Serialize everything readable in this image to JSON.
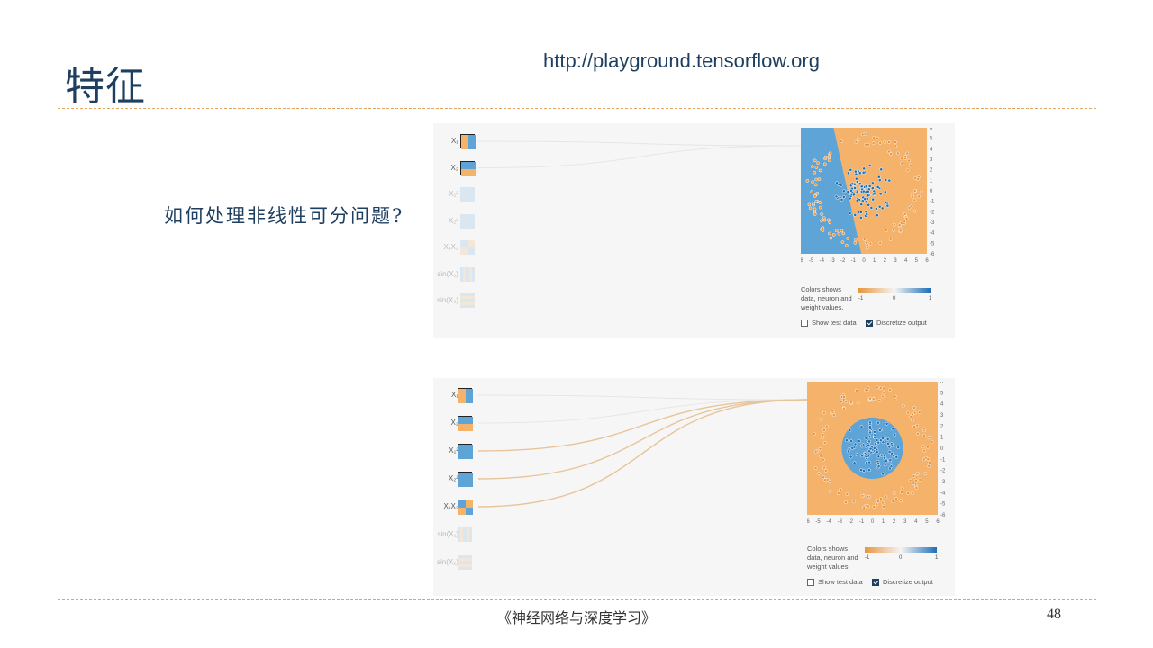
{
  "slide": {
    "title": "特征",
    "url": "http://playground.tensorflow.org",
    "question": "如何处理非线性可分问题?",
    "footer": "《神经网络与深度学习》",
    "page_number": "48"
  },
  "playground_1": {
    "features": [
      {
        "label": "X₁",
        "active": true,
        "icon": "vertical-split"
      },
      {
        "label": "X₂",
        "active": true,
        "icon": "horizontal-split"
      },
      {
        "label": "X₁²",
        "active": false,
        "icon": "solid"
      },
      {
        "label": "X₂²",
        "active": false,
        "icon": "solid"
      },
      {
        "label": "X₁X₂",
        "active": false,
        "icon": "quadrants"
      },
      {
        "label": "sin(X₁)",
        "active": false,
        "icon": "vertical-stripes"
      },
      {
        "label": "sin(X₂)",
        "active": false,
        "icon": "horizontal-stripes"
      }
    ],
    "legend": {
      "text": "Colors shows data, neuron and weight values.",
      "min": "-1",
      "mid": "0",
      "max": "1"
    },
    "options": {
      "show_test_data": "Show test data",
      "show_test_data_checked": false,
      "discretize_output": "Discretize output",
      "discretize_output_checked": true
    },
    "x_ticks": [
      "-6",
      "-5",
      "-4",
      "-3",
      "-2",
      "-1",
      "0",
      "1",
      "2",
      "3",
      "4",
      "5",
      "6"
    ],
    "y_ticks": [
      "6",
      "5",
      "4",
      "3",
      "2",
      "1",
      "0",
      "-1",
      "-2",
      "-3",
      "-4",
      "-5",
      "-6"
    ],
    "decision_boundary": "linear"
  },
  "playground_2": {
    "features": [
      {
        "label": "X₁",
        "active": true,
        "icon": "vertical-split"
      },
      {
        "label": "X₂",
        "active": true,
        "icon": "horizontal-split"
      },
      {
        "label": "X₁²",
        "active": true,
        "icon": "solid"
      },
      {
        "label": "X₂²",
        "active": true,
        "icon": "solid"
      },
      {
        "label": "X₁X₂",
        "active": true,
        "icon": "quadrants"
      },
      {
        "label": "sin(X₁)",
        "active": false,
        "icon": "vertical-stripes"
      },
      {
        "label": "sin(X₂)",
        "active": false,
        "icon": "horizontal-stripes"
      }
    ],
    "legend": {
      "text": "Colors shows data, neuron and weight values.",
      "min": "-1",
      "mid": "0",
      "max": "1"
    },
    "options": {
      "show_test_data": "Show test data",
      "show_test_data_checked": false,
      "discretize_output": "Discretize output",
      "discretize_output_checked": true
    },
    "x_ticks": [
      "-6",
      "-5",
      "-4",
      "-3",
      "-2",
      "-1",
      "0",
      "1",
      "2",
      "3",
      "4",
      "5",
      "6"
    ],
    "y_ticks": [
      "6",
      "5",
      "4",
      "3",
      "2",
      "1",
      "0",
      "-1",
      "-2",
      "-3",
      "-4",
      "-5",
      "-6"
    ],
    "decision_boundary": "circle"
  },
  "colors": {
    "orange": "#f5b26b",
    "blue": "#5ea4d6",
    "dot_blue": "#1f6fb5",
    "dot_orange": "#e8953c",
    "bg": "#f6f6f6"
  }
}
